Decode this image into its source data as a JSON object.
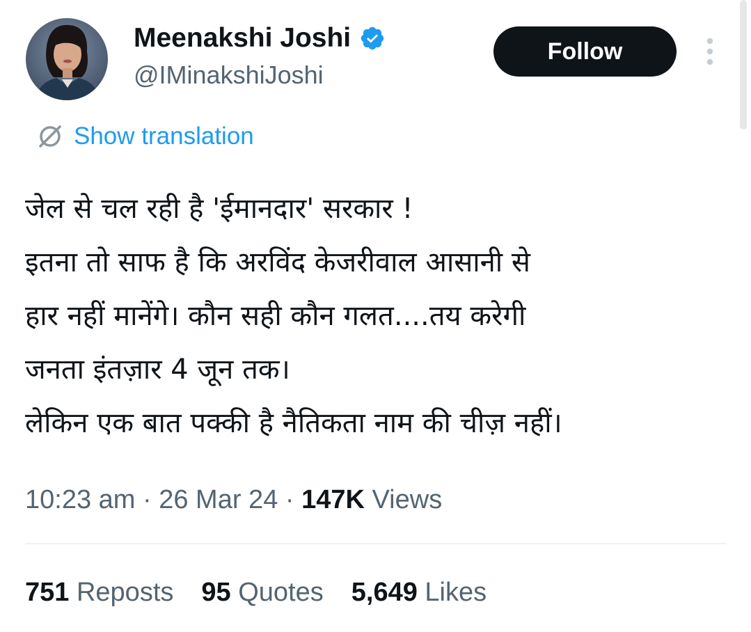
{
  "header": {
    "display_name": "Meenakshi Joshi",
    "handle": "@IMinakshiJoshi",
    "verified": true,
    "follow_label": "Follow"
  },
  "translation": {
    "label": "Show translation",
    "icon": "translate-icon"
  },
  "tweet": {
    "lines": [
      "जेल से चल रही है 'ईमानदार' सरकार !",
      "इतना तो साफ है कि अरविंद केजरीवाल आसानी से",
      "हार नहीं मानेंगे। कौन सही कौन गलत....तय करेगी",
      "जनता इंतज़ार 4 जून तक।",
      "लेकिन एक बात पक्की है नैतिकता नाम की चीज़ नहीं।"
    ]
  },
  "meta": {
    "time": "10:23 am",
    "separator": "·",
    "date": "26 Mar 24",
    "views_count": "147K",
    "views_label": "Views"
  },
  "stats": {
    "reposts_count": "751",
    "reposts_label": "Reposts",
    "quotes_count": "95",
    "quotes_label": "Quotes",
    "likes_count": "5,649",
    "likes_label": "Likes"
  },
  "colors": {
    "link_blue": "#1d9bf0",
    "text_primary": "#0f1419",
    "text_secondary": "#536471",
    "follow_bg": "#0f1419",
    "divider": "#eff3f4"
  }
}
